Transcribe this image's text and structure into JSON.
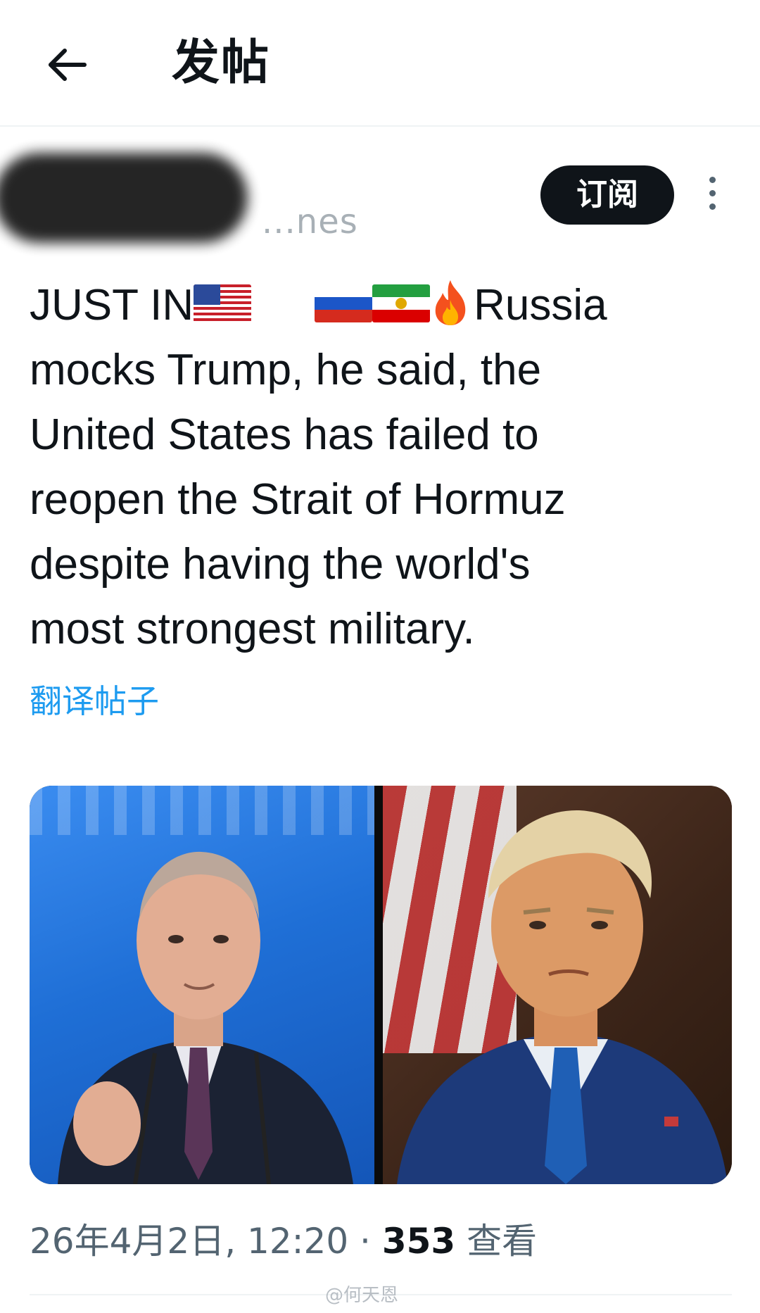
{
  "header": {
    "title": "发帖",
    "back_icon": "arrow-left-icon"
  },
  "author": {
    "handle_fragment": "...nes",
    "subscribe_label": "订阅",
    "more_icon": "more-vertical-icon"
  },
  "post": {
    "lines": [
      "JUST IN",
      "Russia",
      "mocks Trump, he said, the",
      "United States has failed to",
      "reopen the Strait of Hormuz",
      "despite having the world's",
      "most strongest military."
    ],
    "emojis": [
      "us-flag-icon",
      "russia-flag-icon",
      "iran-flag-icon",
      "fire-icon"
    ],
    "translate_label": "翻译帖子"
  },
  "media": {
    "left_photo_icon": "putin-photo",
    "right_photo_icon": "trump-photo"
  },
  "meta": {
    "timestamp": "26年4月2日, 12:20",
    "separator": "·",
    "views_count": "353",
    "views_label": "查看"
  },
  "watermark": "@何天恩",
  "colors": {
    "link": "#1d9bf0",
    "subscribe_bg": "#0f1419",
    "muted_text": "#536471"
  }
}
